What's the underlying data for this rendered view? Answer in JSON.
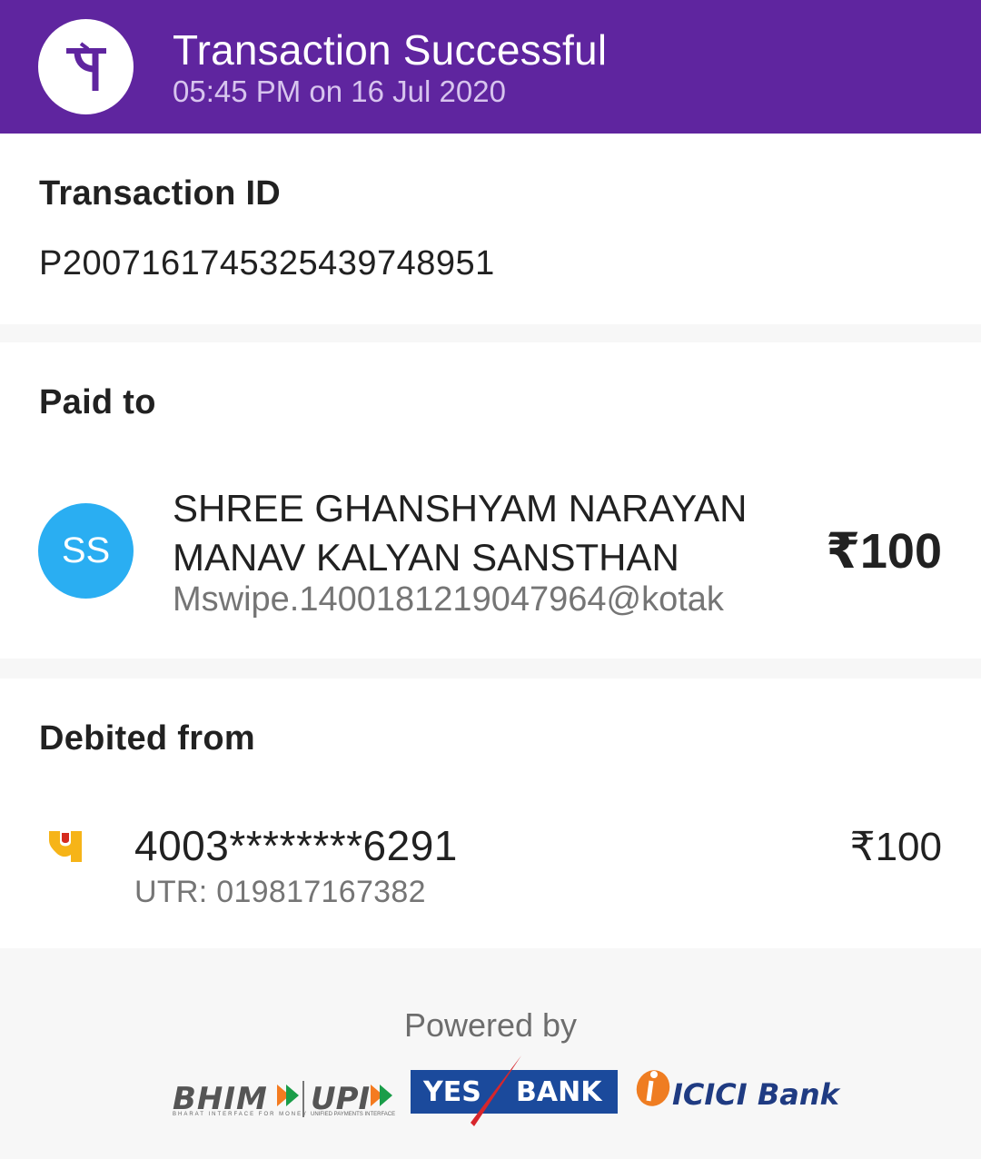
{
  "header": {
    "title": "Transaction Successful",
    "datetime": "05:45 PM on 16 Jul 2020",
    "logo_glyph": "पे",
    "logo_icon": "phonepe-logo-icon",
    "bg_color": "#5f259f"
  },
  "transaction": {
    "label": "Transaction ID",
    "id": "P2007161745325439748951"
  },
  "paid_to": {
    "label": "Paid to",
    "avatar_initials": "SS",
    "avatar_color": "#2aaef2",
    "name": "SHREE GHANSHYAM NARAYAN MANAV KALYAN SANSTHAN",
    "vpa": "Mswipe.1400181219047964@kotak",
    "amount": "₹100"
  },
  "debited_from": {
    "label": "Debited from",
    "bank_icon": "pnb-bank-icon",
    "account": "4003********6291",
    "utr": "UTR: 019817167382",
    "amount": "₹100"
  },
  "footer": {
    "powered_by": "Powered by",
    "bhim": "BHIM",
    "bhim_tagline": "BHARAT INTERFACE FOR MONEY",
    "upi": "UPI",
    "upi_tagline": "UNIFIED PAYMENTS INTERFACE",
    "yes_left": "YES",
    "yes_right": "BANK",
    "icici": "ICICI Bank"
  }
}
